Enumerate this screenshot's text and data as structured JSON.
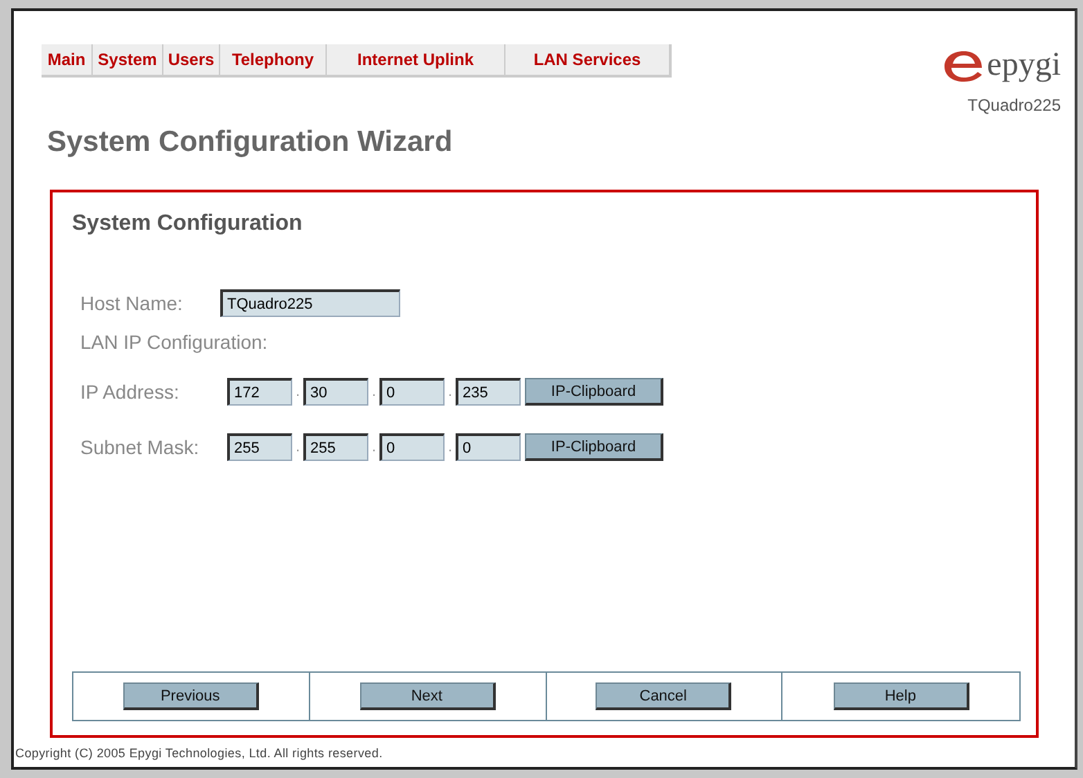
{
  "nav_tabs": [
    {
      "label": "Main"
    },
    {
      "label": "System"
    },
    {
      "label": "Users"
    },
    {
      "label": "Telephony"
    },
    {
      "label": "Internet Uplink"
    },
    {
      "label": "LAN Services"
    }
  ],
  "logo": {
    "text": "epygi"
  },
  "device_model": "TQuadro225",
  "page_title": "System Configuration Wizard",
  "panel": {
    "title": "System Configuration",
    "host_name": {
      "label": "Host Name:",
      "value": "TQuadro225"
    },
    "section_label": "LAN IP Configuration:",
    "ip_rows": [
      {
        "label": "IP Address:",
        "octets": [
          "172",
          "30",
          "0",
          "235"
        ],
        "separator": ".",
        "button": "IP-Clipboard"
      },
      {
        "label": "Subnet Mask:",
        "octets": [
          "255",
          "255",
          "0",
          "0"
        ],
        "separator": ".",
        "button": "IP-Clipboard"
      }
    ],
    "buttons": [
      "Previous",
      "Next",
      "Cancel",
      "Help"
    ]
  },
  "footer": "Copyright (C) 2005 Epygi Technologies, Ltd. All rights reserved."
}
